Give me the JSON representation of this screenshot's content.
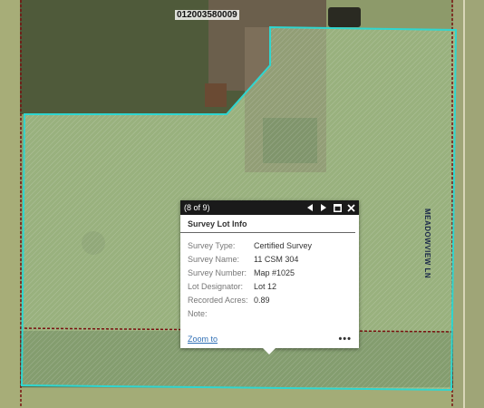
{
  "map": {
    "parcel_label": "012003580009",
    "road_label": "MEADOWVIEW LN",
    "colors": {
      "selection_outline": "#2fd6d0",
      "parcel_line": "#7a1010",
      "lawn": "#8f9a6e"
    }
  },
  "popup": {
    "counter": "(8 of 9)",
    "title": "Survey Lot Info",
    "fields": [
      {
        "label": "Survey Type:",
        "value": "Certified Survey"
      },
      {
        "label": "Survey Name:",
        "value": "11 CSM 304"
      },
      {
        "label": "Survey Number:",
        "value": "Map #1025"
      },
      {
        "label": "Lot Designator:",
        "value": "Lot 12"
      },
      {
        "label": "Recorded Acres:",
        "value": "0.89"
      },
      {
        "label": "Note:",
        "value": ""
      }
    ],
    "zoom_label": "Zoom to",
    "more_label": "•••",
    "icons": {
      "prev": "previous-feature-icon",
      "next": "next-feature-icon",
      "maximize": "maximize-icon",
      "close": "close-icon"
    }
  }
}
